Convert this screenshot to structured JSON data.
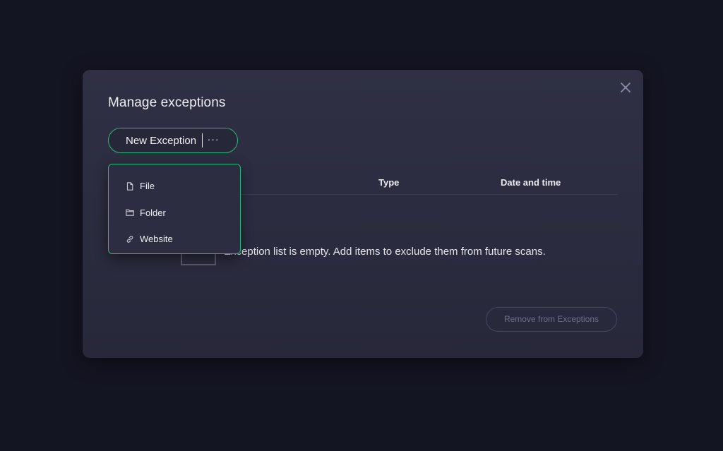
{
  "dialog": {
    "title": "Manage exceptions",
    "new_exception_label": "New Exception",
    "more_label": "···",
    "table": {
      "columns": [
        "",
        "Type",
        "Date and time"
      ]
    },
    "empty_message": "Exception list is empty. Add items to exclude them from future scans.",
    "remove_label": "Remove from Exceptions"
  },
  "dropdown": {
    "items": [
      {
        "label": "File",
        "icon": "file-icon"
      },
      {
        "label": "Folder",
        "icon": "folder-icon"
      },
      {
        "label": "Website",
        "icon": "link-icon"
      }
    ]
  },
  "colors": {
    "accent": "#2fb57e",
    "background": "#141522",
    "panel": "#2b2c3f",
    "text": "#eceef4",
    "disabled_text": "#6f7089"
  }
}
